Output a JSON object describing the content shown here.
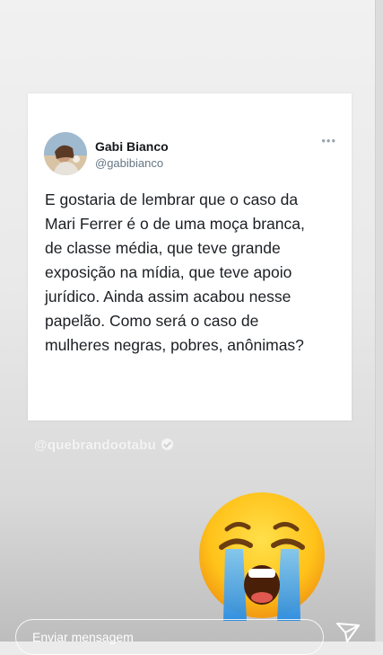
{
  "tweet": {
    "display_name": "Gabi Bianco",
    "handle": "@gabibianco",
    "text": "E gostaria de lembrar que o caso da\nMari Ferrer é o de uma moça branca,\nde classe média, que teve grande\nexposição na mídia, que teve apoio\njurídico. Ainda assim acabou nesse\npapelão. Como será o caso de\nmulheres negras, pobres, anônimas?"
  },
  "watermark": {
    "text": "@quebrandootabu"
  },
  "sticker": {
    "icon": "loudly-crying-face-icon"
  },
  "composer": {
    "placeholder": "Enviar mensagem",
    "send_icon": "paper-plane-icon"
  },
  "colors": {
    "background": "#ebebeb",
    "card": "#ffffff",
    "name": "#14171a",
    "handle": "#657786"
  }
}
